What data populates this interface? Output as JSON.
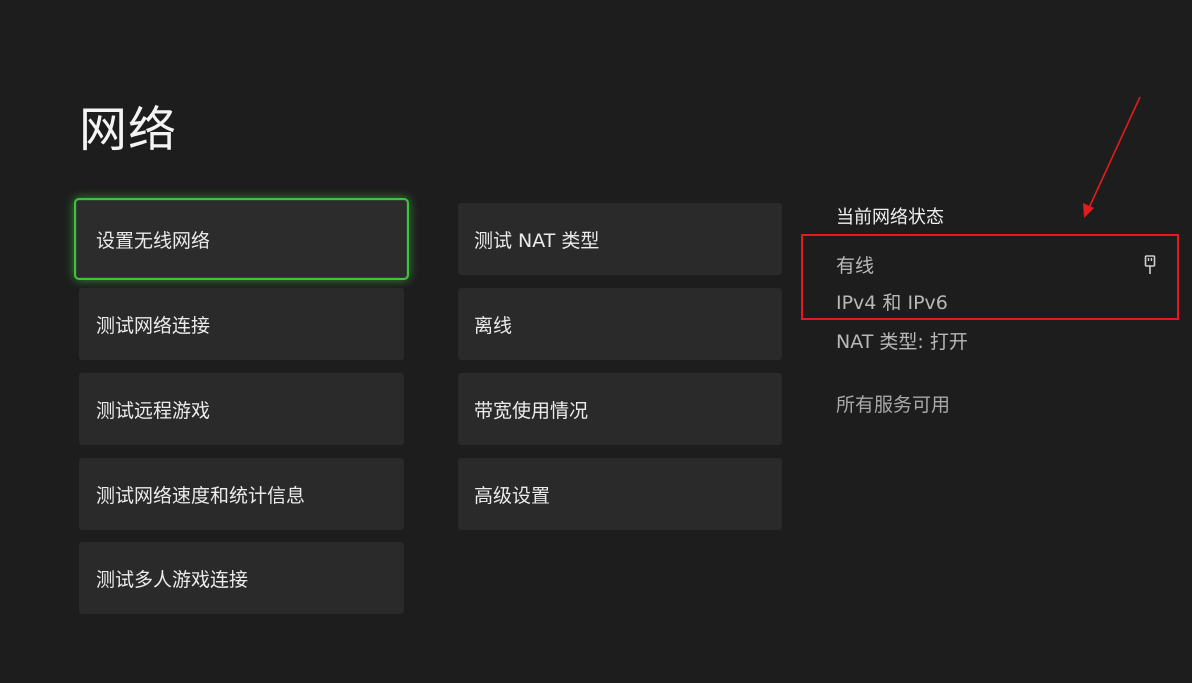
{
  "page": {
    "title": "网络"
  },
  "menu_left": [
    {
      "label": "设置无线网络",
      "focused": true
    },
    {
      "label": "测试网络连接"
    },
    {
      "label": "测试远程游戏"
    },
    {
      "label": "测试网络速度和统计信息"
    },
    {
      "label": "测试多人游戏连接"
    }
  ],
  "menu_right": [
    {
      "label": "测试 NAT 类型"
    },
    {
      "label": "离线"
    },
    {
      "label": "带宽使用情况"
    },
    {
      "label": "高级设置"
    }
  ],
  "status": {
    "heading": "当前网络状态",
    "connection": "有线",
    "ip_version": "IPv4 和 IPv6",
    "nat": "NAT 类型: 打开",
    "services": "所有服务可用",
    "connection_icon": "ethernet-plug-icon"
  },
  "colors": {
    "background": "#1d1d1d",
    "tile": "#2a2a2a",
    "focus_green": "#3fc33f",
    "annotation_red": "#e21c1c"
  }
}
